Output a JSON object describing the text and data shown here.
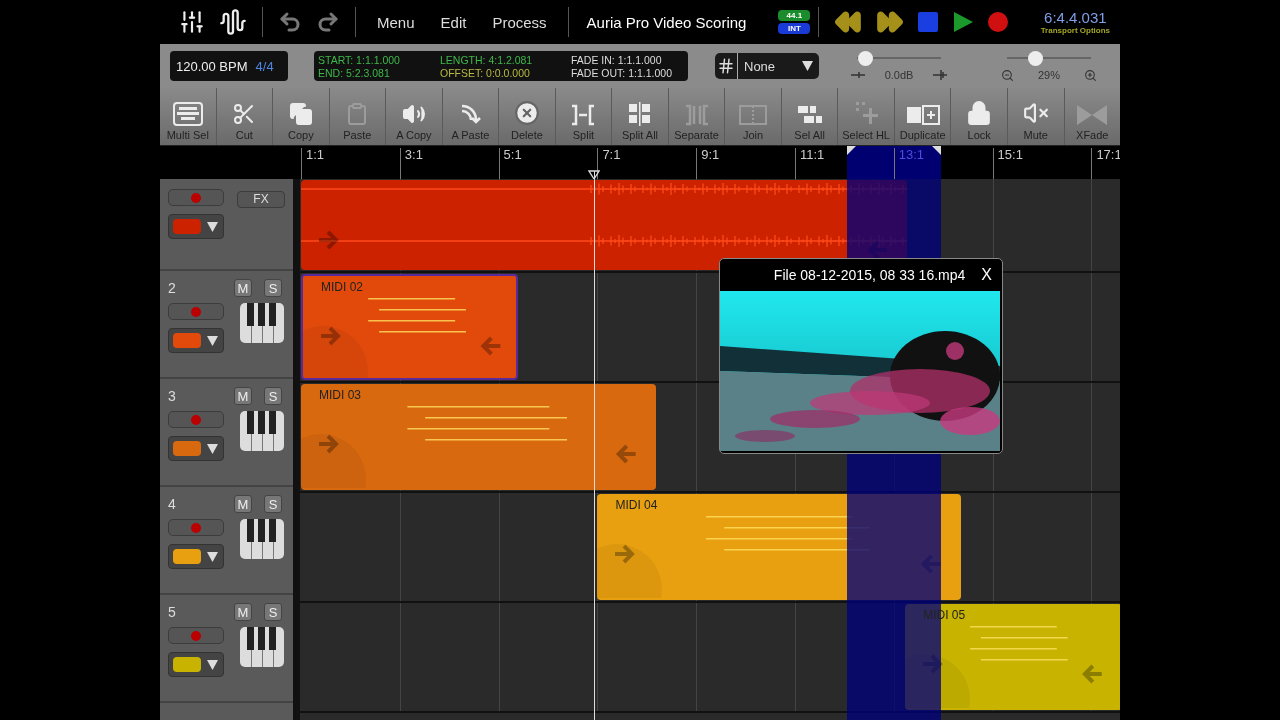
{
  "top_bar": {
    "menus": [
      "Menu",
      "Edit",
      "Process"
    ],
    "title": "Auria Pro Video Scoring",
    "sample_rate": "44.1",
    "clock_source": "INT",
    "counter": "6:4.4.031",
    "transport_options": "Transport Options"
  },
  "info_bar": {
    "tempo": "120.00 BPM",
    "meter": "4/4",
    "region_info": {
      "start": "START: 1:1.1.000",
      "end": "END: 5:2.3.081",
      "length": "LENGTH: 4:1.2.081",
      "offset": "OFFSET: 0:0.0.000",
      "fade_in": "FADE IN: 1:1.1.000",
      "fade_out": "FADE OUT: 1:1.1.000"
    },
    "snap": {
      "value": "None"
    },
    "volume": {
      "level": 0.1,
      "reading": "0.0dB"
    },
    "zoom": {
      "level": 0.33,
      "reading": "29%"
    }
  },
  "toolbar": [
    {
      "label": "Multi Sel",
      "disabled": false
    },
    {
      "label": "Cut",
      "disabled": false
    },
    {
      "label": "Copy",
      "disabled": false
    },
    {
      "label": "Paste",
      "disabled": true
    },
    {
      "label": "A Copy",
      "disabled": false
    },
    {
      "label": "A Paste",
      "disabled": false
    },
    {
      "label": "Delete",
      "disabled": false
    },
    {
      "label": "Split",
      "disabled": false
    },
    {
      "label": "Split All",
      "disabled": false
    },
    {
      "label": "Separate",
      "disabled": true
    },
    {
      "label": "Join",
      "disabled": true
    },
    {
      "label": "Sel All",
      "disabled": false
    },
    {
      "label": "Select HL",
      "disabled": true
    },
    {
      "label": "Duplicate",
      "disabled": false
    },
    {
      "label": "Lock",
      "disabled": false
    },
    {
      "label": "Mute",
      "disabled": false
    },
    {
      "label": "XFade",
      "disabled": true
    }
  ],
  "ruler": [
    {
      "label": "1:1",
      "highlighted": false
    },
    {
      "label": "3:1",
      "highlighted": false
    },
    {
      "label": "5:1",
      "highlighted": false
    },
    {
      "label": "7:1",
      "highlighted": false
    },
    {
      "label": "9:1",
      "highlighted": false
    },
    {
      "label": "11:1",
      "highlighted": false
    },
    {
      "label": "13:1",
      "highlighted": true
    },
    {
      "label": "15:1",
      "highlighted": false
    },
    {
      "label": "17:1",
      "highlighted": false
    }
  ],
  "tracks": [
    {
      "kind": "audio",
      "fx": "FX",
      "color": "#cc2200",
      "clip": {
        "selected": false
      }
    },
    {
      "kind": "midi",
      "number": "2",
      "mute": "M",
      "solo": "S",
      "color": "#e24a0c",
      "clip": {
        "name": "MIDI 02",
        "selected": true
      }
    },
    {
      "kind": "midi",
      "number": "3",
      "mute": "M",
      "solo": "S",
      "color": "#d9690f",
      "clip": {
        "name": "MIDI 03",
        "selected": false
      }
    },
    {
      "kind": "midi",
      "number": "4",
      "mute": "M",
      "solo": "S",
      "color": "#e8a010",
      "clip": {
        "name": "MIDI 04",
        "selected": false
      }
    },
    {
      "kind": "midi",
      "number": "5",
      "mute": "M",
      "solo": "S",
      "color": "#c8b400",
      "clip": {
        "name": "MIDI 05",
        "selected": false
      }
    }
  ],
  "video_window": {
    "title": "File 08-12-2015, 08 33 16.mp4",
    "close": "X",
    "kind": "picture"
  }
}
